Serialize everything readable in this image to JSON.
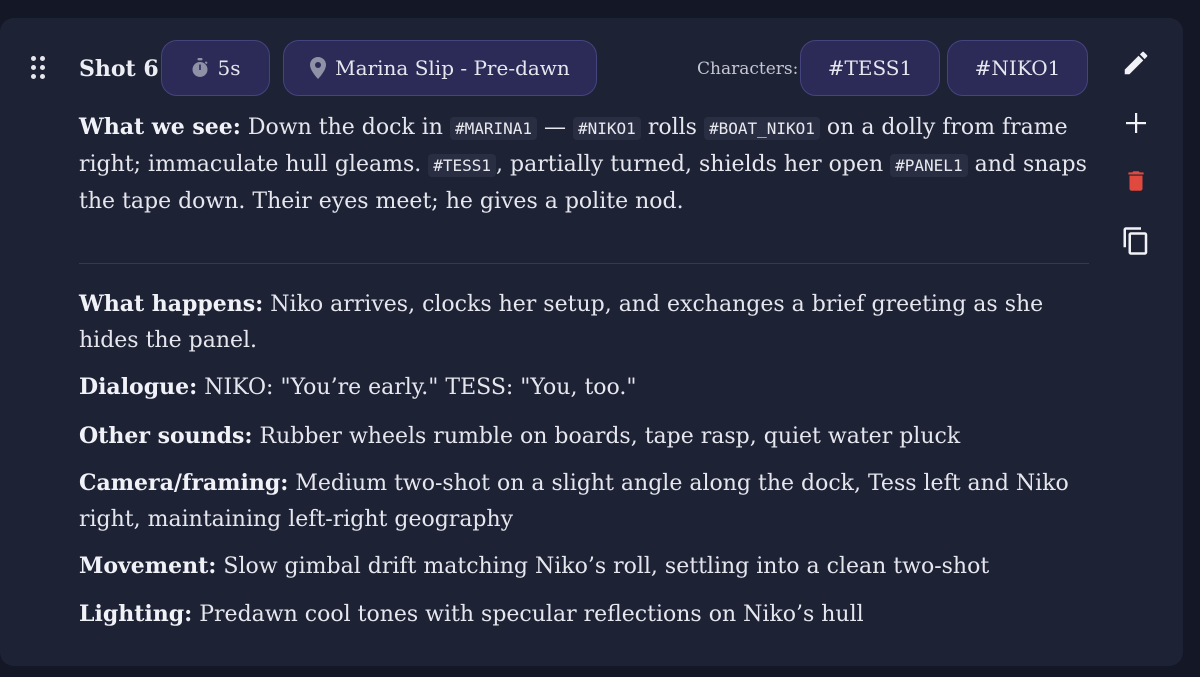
{
  "shot": {
    "title": "Shot 6",
    "duration": "5s",
    "location": "Marina Slip - Pre-dawn",
    "characters_label": "Characters:",
    "characters": [
      "#TESS1",
      "#NIKO1"
    ]
  },
  "what_we_see": {
    "label": "What we see:",
    "t1": "Down the dock in",
    "c1": "#MARINA1",
    "t2": "—",
    "c2": "#NIKO1",
    "t3": "rolls",
    "c3": "#BOAT_NIKO1",
    "t4": "on a dolly from frame right; immaculate hull gleams.",
    "c4": "#TESS1",
    "t5": ", partially turned, shields her open",
    "c5": "#PANEL1",
    "t6": "and snaps the tape down. Their eyes meet; he gives a polite nod."
  },
  "details": {
    "happens_label": "What happens:",
    "happens": "Niko arrives, clocks her setup, and exchanges a brief greeting as she hides the panel.",
    "dialogue_label": "Dialogue:",
    "dialogue": "NIKO: \"You’re early.\" TESS: \"You, too.\"",
    "sounds_label": "Other sounds:",
    "sounds": "Rubber wheels rumble on boards, tape rasp, quiet water pluck",
    "camera_label": "Camera/framing:",
    "camera": "Medium two-shot on a slight angle along the dock, Tess left and Niko right, maintaining left-right geography",
    "movement_label": "Movement:",
    "movement": "Slow gimbal drift matching Niko’s roll, settling into a clean two-shot",
    "lighting_label": "Lighting:",
    "lighting": "Predawn cool tones with specular reflections on Niko’s hull"
  },
  "icons": {
    "drag": "drag-handle-icon",
    "timer": "stopwatch-icon",
    "location": "map-pin-icon",
    "edit": "pencil-icon",
    "add": "plus-icon",
    "delete": "trash-icon",
    "copy": "copy-icon"
  },
  "colors": {
    "background": "#141826",
    "card": "#1e2235",
    "chip": "#2c2b58",
    "chip_border": "#45447e",
    "delete": "#e0493e"
  }
}
